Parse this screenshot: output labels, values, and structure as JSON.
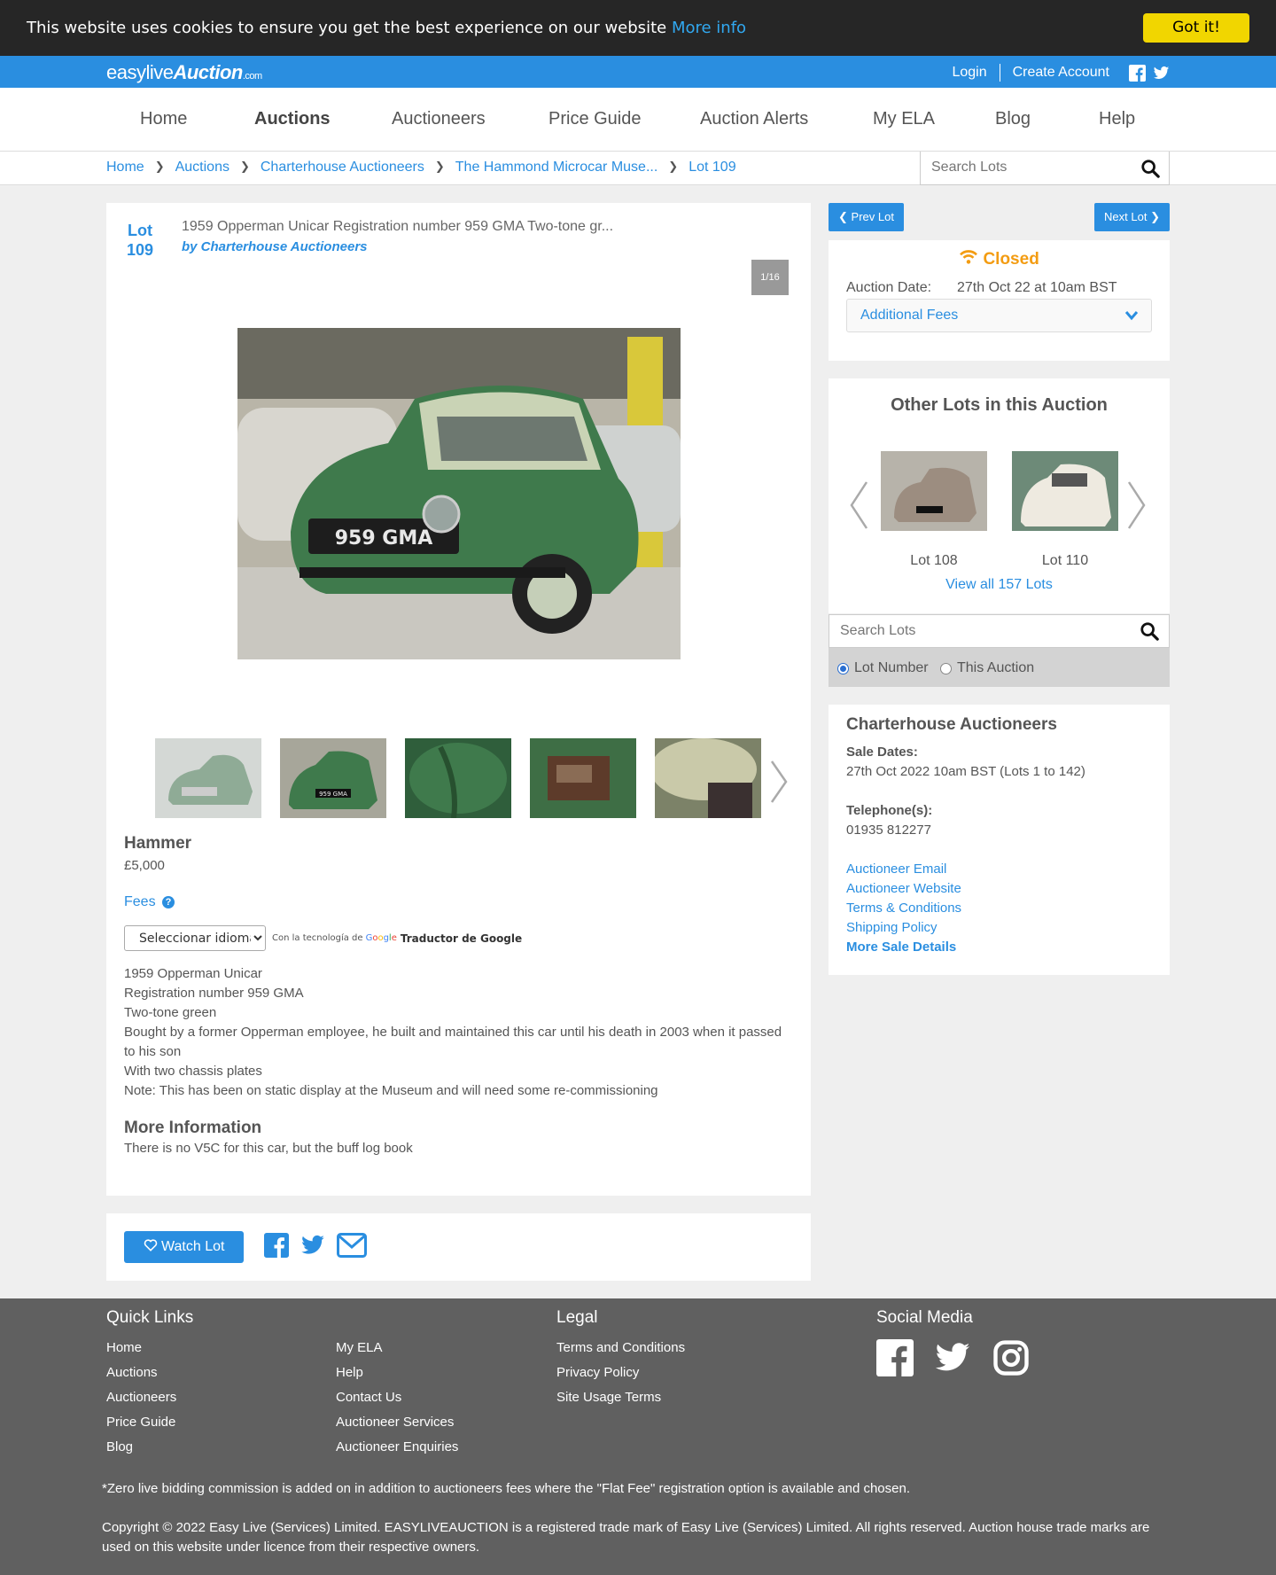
{
  "cookie": {
    "message": "This website uses cookies to ensure you get the best experience on our website",
    "more_info": "More info",
    "got_it": "Got it!"
  },
  "topbar": {
    "logo_easylive": "easylive",
    "logo_auction": "Auction",
    "logo_com": ".com",
    "login": "Login",
    "create_account": "Create Account",
    "icons": [
      "facebook-icon",
      "twitter-icon"
    ]
  },
  "nav": {
    "items": [
      "Home",
      "Auctions",
      "Auctioneers",
      "Price Guide",
      "Auction Alerts",
      "My ELA",
      "Blog",
      "Help"
    ],
    "active": "Auctions"
  },
  "breadcrumb": [
    "Home",
    "Auctions",
    "Charterhouse Auctioneers",
    "The Hammond Microcar Muse...",
    "Lot 109"
  ],
  "search": {
    "placeholder": "Search Lots"
  },
  "lot": {
    "lot_label": "Lot",
    "lot_number": "109",
    "title": "1959 Opperman Unicar Registration number 959 GMA Two-tone gr...",
    "by": "by Charterhouse Auctioneers",
    "image_counter": "1/16",
    "hammer_label": "Hammer",
    "hammer_value": "£5,000",
    "fees": "Fees",
    "translate_select": "Seleccionar idioma",
    "translate_powered": "Con la tecnología de",
    "translate_google": "Google",
    "translate_name": "Traductor de Google",
    "description": [
      "1959 Opperman Unicar",
      "Registration number 959 GMA",
      "Two-tone green",
      "Bought by a former Opperman employee, he built and maintained this car until his death in 2003 when it passed to his son",
      "With two chassis plates",
      "Note: This has been on static display at the Museum and will need some re-commissioning"
    ],
    "more_info_heading": "More Information",
    "more_info_text": "There is no V5C for this car, but the buff log book",
    "watch_lot": "Watch Lot",
    "share_icons": [
      "facebook-icon",
      "twitter-icon",
      "envelope-icon"
    ]
  },
  "side": {
    "prev_lot": "Prev Lot",
    "next_lot": "Next Lot",
    "status": "Closed",
    "auction_date_label": "Auction Date:",
    "auction_date_value": "27th Oct 22 at 10am BST",
    "additional_fees": "Additional Fees",
    "other_lots_heading": "Other Lots in this Auction",
    "other_lots": [
      "Lot 108",
      "Lot 110"
    ],
    "view_all": "View all 157 Lots",
    "search_placeholder": "Search Lots",
    "radio_lot_number": "Lot Number",
    "radio_this_auction": "This Auction",
    "auctioneer": "Charterhouse Auctioneers",
    "sale_dates_label": "Sale Dates:",
    "sale_dates_value": "27th Oct 2022 10am BST (Lots 1 to 142)",
    "telephone_label": "Telephone(s):",
    "telephone_value": "01935 812277",
    "links": [
      "Auctioneer Email",
      "Auctioneer Website",
      "Terms & Conditions",
      "Shipping Policy"
    ],
    "more_sale_details": "More Sale Details"
  },
  "footer": {
    "quick_links_heading": "Quick Links",
    "quick_links_col1": [
      "Home",
      "Auctions",
      "Auctioneers",
      "Price Guide",
      "Blog"
    ],
    "quick_links_col2": [
      "My ELA",
      "Help",
      "Contact Us",
      "Auctioneer Services",
      "Auctioneer Enquiries"
    ],
    "legal_heading": "Legal",
    "legal_links": [
      "Terms and Conditions",
      "Privacy Policy",
      "Site Usage Terms"
    ],
    "social_heading": "Social Media",
    "social_icons": [
      "facebook-icon",
      "twitter-icon",
      "instagram-icon"
    ],
    "commission_note": "*Zero live bidding commission is added on in addition to auctioneers fees where the \"Flat Fee\" registration option is available and chosen.",
    "copyright": "Copyright © 2022 Easy Live (Services) Limited. EASYLIVEAUCTION is a registered trade mark of Easy Live (Services) Limited. All rights reserved. Auction house trade marks are used on this website under licence from their respective owners."
  },
  "colors": {
    "brand_blue": "#2a8ee0",
    "closed_orange": "#f39c12",
    "cookie_button": "#f1d600",
    "footer_bg": "#606060"
  }
}
